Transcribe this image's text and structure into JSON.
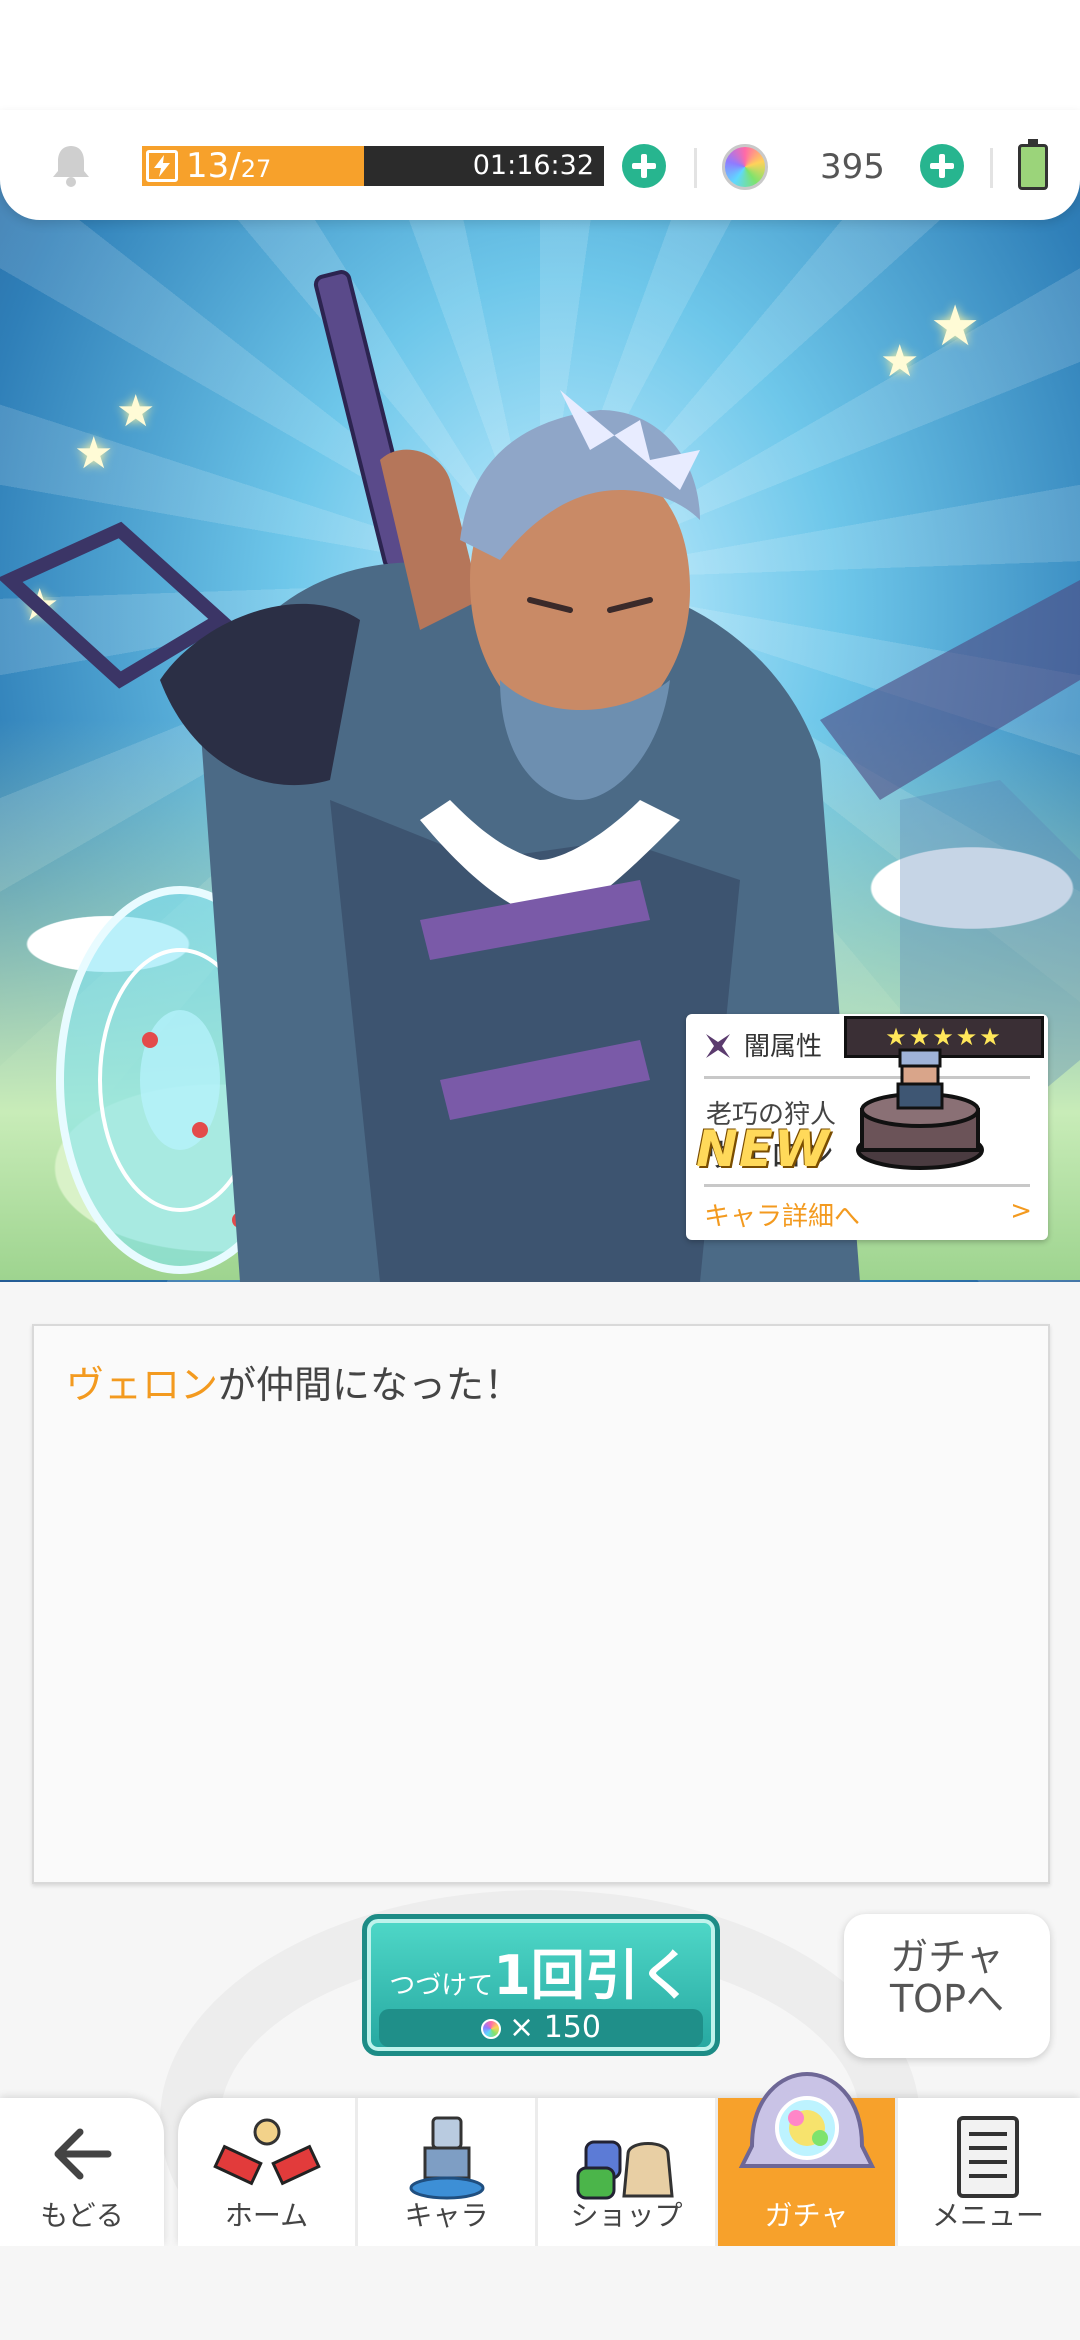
{
  "status_bar": {
    "stamina_current": "13/",
    "stamina_max": "27",
    "stamina_fraction": 0.48,
    "timer": "01:16:32",
    "gem_count": "395"
  },
  "result": {
    "new_badge": "NEW",
    "attribute": "闇属性",
    "rarity_stars": "★★★★★",
    "character_title": "老巧の狩人",
    "character_name": "ヴェロン",
    "detail_link": "キャラ詳細へ",
    "detail_arrow": ">"
  },
  "message": {
    "name": "ヴェロン",
    "suffix": "が仲間になった！"
  },
  "pull_button": {
    "prefix": "つづけて",
    "main": "1回引く",
    "cost": "× 150"
  },
  "gacha_top_button": {
    "line1": "ガチャ",
    "line2": "TOPへ"
  },
  "nav": {
    "back": "もどる",
    "home": "ホーム",
    "chara": "キャラ",
    "shop": "ショップ",
    "gacha": "ガチャ",
    "menu": "メニュー"
  },
  "colors": {
    "accent_orange": "#f7a12b",
    "teal_button": "#26a7a0",
    "plus_green": "#27b58f"
  }
}
